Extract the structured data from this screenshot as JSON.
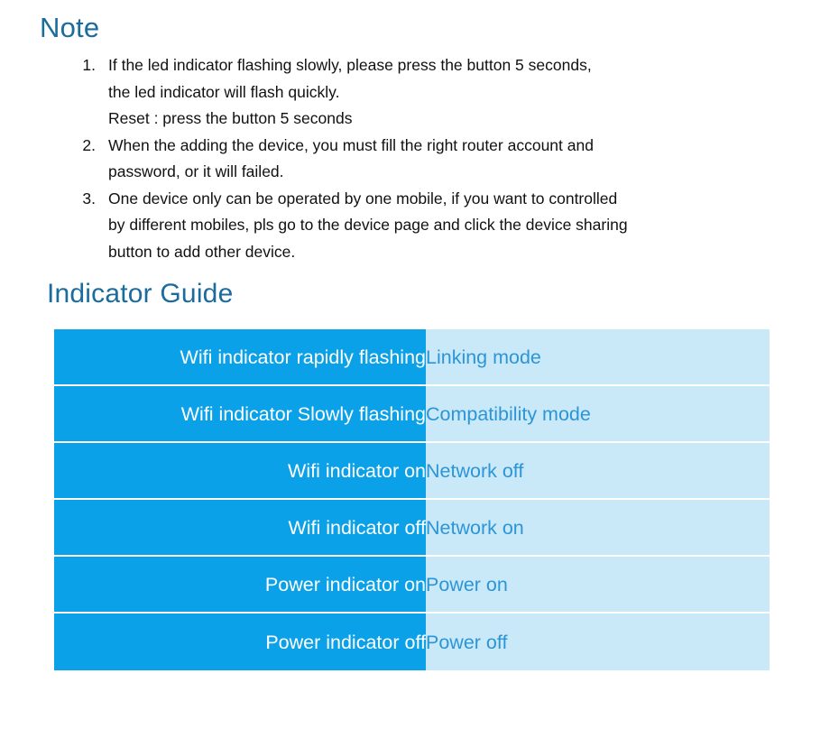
{
  "note": {
    "heading": "Note",
    "items": [
      {
        "number": "1.",
        "lines": [
          "If the led indicator flashing slowly, please press the button 5 seconds,",
          "the led indicator will flash quickly.",
          "Reset : press the button 5 seconds"
        ]
      },
      {
        "number": "2.",
        "lines": [
          "When the adding the device, you must fill the right router account and",
          "password, or it will failed."
        ]
      },
      {
        "number": "3.",
        "lines": [
          "One device only can be operated by one mobile, if you want to controlled",
          "by different mobiles, pls go to the device page and click the device sharing",
          "button to add other device."
        ]
      }
    ]
  },
  "indicator_guide": {
    "heading": "Indicator Guide",
    "rows": [
      {
        "state": "Wifi indicator rapidly flashing",
        "meaning": "Linking mode"
      },
      {
        "state": "Wifi indicator Slowly flashing",
        "meaning": "Compatibility mode"
      },
      {
        "state": "Wifi indicator on",
        "meaning": "Network off"
      },
      {
        "state": "Wifi indicator off",
        "meaning": "Network on"
      },
      {
        "state": "Power indicator on",
        "meaning": "Power on"
      },
      {
        "state": "Power indicator off",
        "meaning": "Power off"
      }
    ]
  },
  "colors": {
    "heading_blue": "#1B6C9E",
    "state_cell_bg": "#0BA1E8",
    "state_cell_text": "#FFFFFF",
    "meaning_cell_bg": "#C9E9F8",
    "meaning_cell_text": "#2C95D6",
    "page_bg": "#FFFFFF",
    "body_text": "#111111"
  }
}
